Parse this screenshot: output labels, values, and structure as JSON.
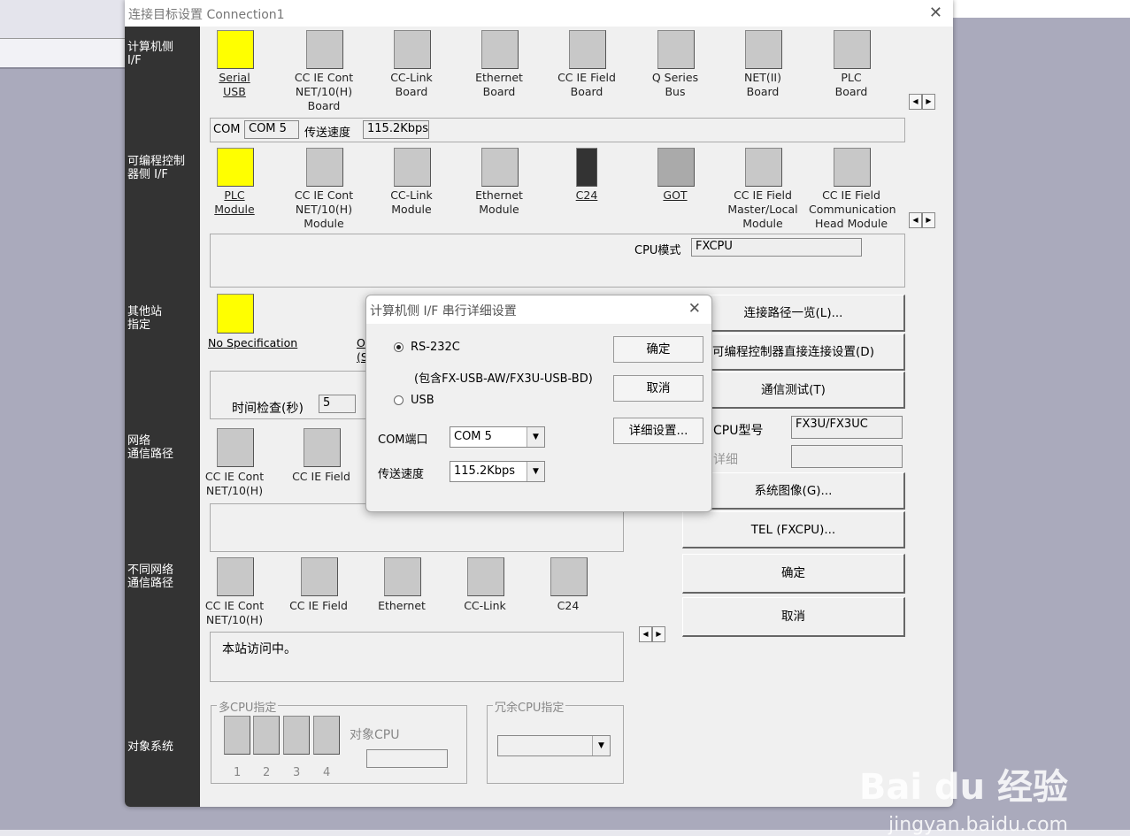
{
  "window": {
    "title": "连接目标设置 Connection1"
  },
  "sidebar": [
    "计算机侧\nI/F",
    "可编程控制\n器侧 I/F",
    "其他站\n指定",
    "网络\n通信路径",
    "不同网络\n通信路径",
    "对象系统"
  ],
  "pc_if": [
    "Serial\nUSB",
    "CC IE Cont\nNET/10(H)\nBoard",
    "CC-Link\nBoard",
    "Ethernet\nBoard",
    "CC IE Field\nBoard",
    "Q Series\nBus",
    "NET(II)\nBoard",
    "PLC\nBoard"
  ],
  "com_row": {
    "com_label": "COM",
    "com_value": "COM 5",
    "speed_label": "传送速度",
    "speed_value": "115.2Kbps"
  },
  "plc_if": [
    "PLC\nModule",
    "CC IE Cont\nNET/10(H)\nModule",
    "CC-Link\nModule",
    "Ethernet\nModule",
    "C24",
    "GOT",
    "CC IE Field\nMaster/Local\nModule",
    "CC IE Field\nCommunication\nHead Module"
  ],
  "cpu_mode": {
    "label": "CPU模式",
    "value": "FXCPU"
  },
  "other_station": {
    "no_spec": "No Specification",
    "partial_1": "O",
    "partial_2": "(S",
    "time_check_label": "时间检查(秒)",
    "time_check_value": "5"
  },
  "network_route": [
    "CC IE Cont\nNET/10(H)",
    "CC IE Field"
  ],
  "diff_network": [
    "CC IE Cont\nNET/10(H)",
    "CC IE Field",
    "Ethernet",
    "CC-Link",
    "C24"
  ],
  "status_text": "本站访问中。",
  "multi_cpu": {
    "title": "多CPU指定",
    "nums": [
      "1",
      "2",
      "3",
      "4"
    ],
    "target_cpu": "对象CPU"
  },
  "redundant": {
    "title": "冗余CPU指定"
  },
  "right_buttons": {
    "route_list": "连接路径一览(L)...",
    "direct": "可编程控制器直接连接设置(D)",
    "test": "通信测试(T)",
    "cpu_type_label": "CPU型号",
    "cpu_type_value": "FX3U/FX3UC",
    "detail_label": "详细",
    "system_image": "系统图像(G)...",
    "tel": "TEL (FXCPU)...",
    "ok": "确定",
    "cancel": "取消"
  },
  "dialog": {
    "title": "计算机侧 I/F 串行详细设置",
    "rs232": "RS-232C",
    "rs232_note": "(包含FX-USB-AW/FX3U-USB-BD)",
    "usb": "USB",
    "com_label": "COM端口",
    "com_value": "COM 5",
    "speed_label": "传送速度",
    "speed_value": "115.2Kbps",
    "ok": "确定",
    "cancel": "取消",
    "detail": "详细设置...",
    "selected": "RS-232C"
  },
  "watermark": {
    "text": "Bai du 经验",
    "url": "jingyan.baidu.com"
  },
  "colors": {
    "sidebar": "#333333",
    "selected_icon": "#ffff00",
    "desktop": "#aaaabc"
  }
}
